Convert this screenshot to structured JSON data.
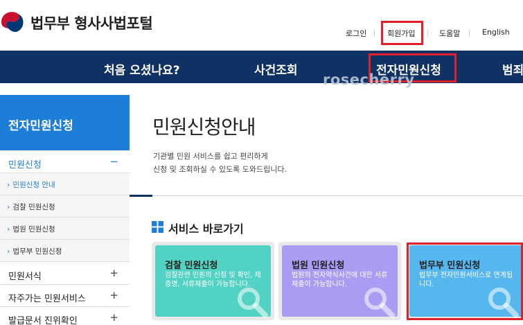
{
  "header": {
    "site_title": "법무부 형사사법포털",
    "util_links": {
      "login": "로그인",
      "signup": "회원가입",
      "help": "도움말",
      "english": "English"
    }
  },
  "gnb": {
    "items": [
      "처음 오셨나요?",
      "사건조회",
      "전자민원신청",
      "범죄"
    ]
  },
  "watermark": "rosecherry",
  "sidebar": {
    "heading": "전자민원신청",
    "menu": [
      {
        "label": "민원신청",
        "sign": "−"
      },
      {
        "label": "민원서식",
        "sign": "+"
      },
      {
        "label": "자주가는 민원서비스",
        "sign": "+"
      },
      {
        "label": "발급문서 진위확인",
        "sign": "+"
      }
    ],
    "submenu": [
      "민원신청 안내",
      "검찰 민원신청",
      "법원 민원신청",
      "법무부 민원신청"
    ]
  },
  "content": {
    "heading": "민원신청안내",
    "desc_lines": [
      "기관별 민원 서비스를 쉽고 편리하게",
      "신청 및 조회하실 수 있도록 도와드립니다."
    ],
    "service_heading": "서비스 바로가기",
    "cards": [
      {
        "title": "검찰 민원신청",
        "desc": "검찰관련 민원의 신청 및 확인, 제증명, 서류제출이 가능합니다."
      },
      {
        "title": "법원 민원신청",
        "desc": "법원의 전자약식사건에 대한 서류제출이 가능합니다."
      },
      {
        "title": "법무부 민원신청",
        "desc": "법무부 전자민원서비스로 연계됩니다."
      }
    ]
  },
  "colors": {
    "navy": "#0f3163",
    "side_blue": "#1c7ed9",
    "highlight_red": "#e0202a",
    "card_prosecution": "#52d2c2",
    "card_court": "#a99cf3",
    "card_ministry": "#56b7ee"
  }
}
